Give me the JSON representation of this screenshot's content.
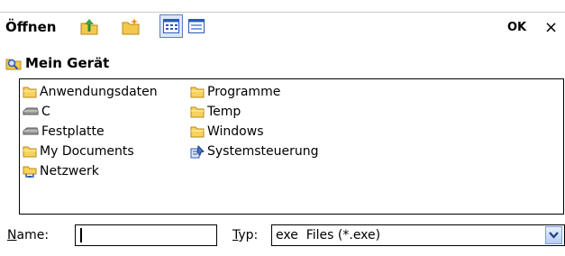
{
  "header": {
    "title": "Öffnen",
    "toolbar_icons": [
      "up-folder-icon",
      "new-folder-icon",
      "list-view-icon",
      "details-view-icon"
    ],
    "ok_label": "OK",
    "close_label": "×"
  },
  "location": {
    "label": "Mein Gerät",
    "icon": "search-folder-icon"
  },
  "files": {
    "column1": [
      {
        "label": "Anwendungsdaten",
        "icon": "folder-icon"
      },
      {
        "label": "C",
        "icon": "drive-icon"
      },
      {
        "label": "Festplatte",
        "icon": "drive-icon"
      },
      {
        "label": "My Documents",
        "icon": "folder-icon"
      },
      {
        "label": "Netzwerk",
        "icon": "network-icon"
      }
    ],
    "column2": [
      {
        "label": "Programme",
        "icon": "folder-icon"
      },
      {
        "label": "Temp",
        "icon": "folder-icon"
      },
      {
        "label": "Windows",
        "icon": "folder-icon"
      },
      {
        "label": "Systemsteuerung",
        "icon": "control-panel-icon"
      }
    ]
  },
  "bottom": {
    "name_label_hotkey": "N",
    "name_label_rest": "ame:",
    "name_value": "",
    "type_label_hotkey": "T",
    "type_label_rest": "yp:",
    "type_value": "exe  Files (*.exe)"
  },
  "colors": {
    "selection_border": "#5f7fc2",
    "folder": "#f7d35b",
    "dropdown": "#7b9fe0"
  }
}
